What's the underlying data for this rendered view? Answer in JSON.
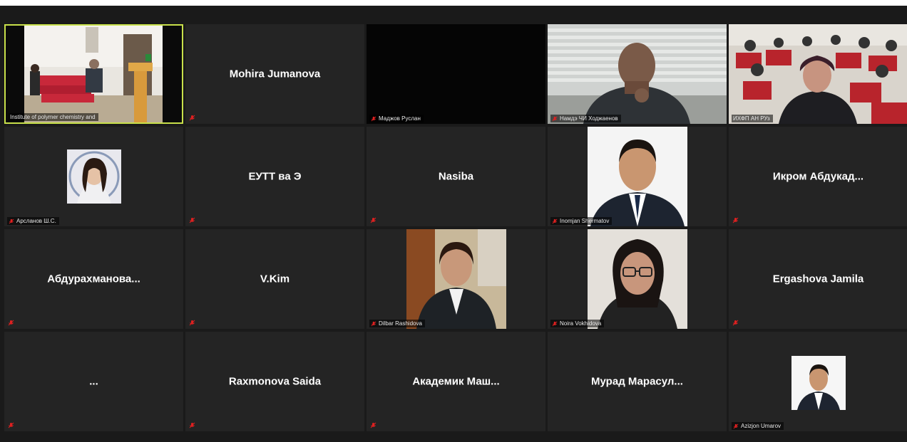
{
  "participants": [
    {
      "name": "Institute of polymer chemistry and",
      "muted": false,
      "video": "hall-podium",
      "active": true
    },
    {
      "name": "Mohira Jumanova",
      "muted": true,
      "video": null
    },
    {
      "name": "Маджов Руслан",
      "muted": true,
      "video": "dark"
    },
    {
      "name": "Намдэ ЧИ Ходжаенов",
      "muted": true,
      "video": "man-blinds"
    },
    {
      "name": "ИХФП АН РУз",
      "muted": false,
      "video": "auditorium"
    },
    {
      "name": "Арсланов Ш.С.",
      "muted": true,
      "video": "avatar-woman"
    },
    {
      "name": "ЕУТТ ва Э",
      "muted": true,
      "video": null
    },
    {
      "name": "Nasiba",
      "muted": true,
      "video": null
    },
    {
      "name": "Inomjan Shermatov",
      "muted": true,
      "video": "portrait-man"
    },
    {
      "name": "Икром Абдукад...",
      "muted": true,
      "video": null
    },
    {
      "name": "Абдурахманова...",
      "muted": true,
      "video": null
    },
    {
      "name": "V.Kim",
      "muted": true,
      "video": null
    },
    {
      "name": "Dilbar Rashidova",
      "muted": true,
      "video": "woman-office"
    },
    {
      "name": "Noira Vokhidova",
      "muted": true,
      "video": "woman-glasses"
    },
    {
      "name": "Ergashova Jamila",
      "muted": true,
      "video": null
    },
    {
      "name": "...",
      "muted": true,
      "video": null
    },
    {
      "name": "Raxmonova Saida",
      "muted": true,
      "video": null
    },
    {
      "name": "Академик Маш...",
      "muted": true,
      "video": null
    },
    {
      "name": "Мурад Марасул...",
      "muted": true,
      "video": null
    },
    {
      "name": "Azizjon Umarov",
      "muted": true,
      "video": "portrait-small"
    }
  ],
  "colors": {
    "background": "#1a1a1a",
    "tile": "#242424",
    "active_border": "#c8e04a",
    "mute_icon": "#e02020"
  },
  "icons": {
    "muted": "mic-muted-icon"
  }
}
